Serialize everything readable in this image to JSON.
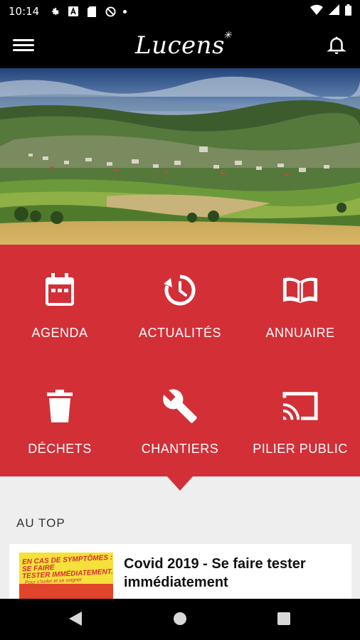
{
  "status_bar": {
    "time": "10:14",
    "left_icons": [
      "gear-icon",
      "a-box-icon",
      "sd-card-icon",
      "no-sync-icon",
      "dot-icon"
    ],
    "right_icons": [
      "wifi-icon",
      "signal-icon",
      "battery-icon"
    ]
  },
  "app_bar": {
    "logo": "Lucens",
    "menu_icon": "hamburger-icon",
    "bell_icon": "bell-icon"
  },
  "hero": {
    "image": "landscape photo of the town of Lucens with hills, fields and a cloudy sky"
  },
  "tiles": [
    {
      "label": "AGENDA",
      "icon": "calendar-icon"
    },
    {
      "label": "ACTUALITÉS",
      "icon": "history-icon"
    },
    {
      "label": "ANNUAIRE",
      "icon": "book-icon"
    },
    {
      "label": "DÉCHETS",
      "icon": "trash-icon"
    },
    {
      "label": "CHANTIERS",
      "icon": "wrench-icon"
    },
    {
      "label": "PILIER PUBLIC",
      "icon": "cast-icon"
    }
  ],
  "section": {
    "title": "AU TOP",
    "card": {
      "title": "Covid 2019 - Se faire tester immédiatement",
      "thumb_lines": [
        "EN CAS DE SYMPTÔMES :",
        "SE FAIRE",
        "TESTER IMMÉDIATEMENT."
      ],
      "thumb_small": "Pour s'isoler et se soigner"
    }
  },
  "colors": {
    "accent_red": "#d32f37",
    "background_grey": "#eeeeee",
    "bar_black": "#000000"
  },
  "nav_bar": {
    "icons": [
      "back-icon",
      "home-icon",
      "recents-icon"
    ]
  }
}
